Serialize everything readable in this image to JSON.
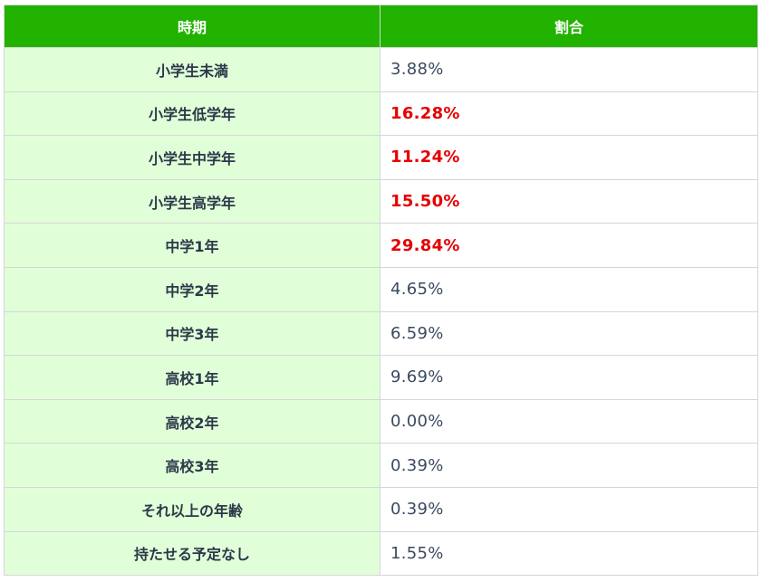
{
  "table": {
    "headers": [
      "時期",
      "割合"
    ],
    "highlight_color": "#e60000",
    "header_color": "#22b200",
    "label_bg_color": "#e0ffd9",
    "rows": [
      {
        "period": "小学生未満",
        "ratio": "3.88%",
        "highlight": false
      },
      {
        "period": "小学生低学年",
        "ratio": "16.28%",
        "highlight": true
      },
      {
        "period": "小学生中学年",
        "ratio": "11.24%",
        "highlight": true
      },
      {
        "period": "小学生高学年",
        "ratio": "15.50%",
        "highlight": true
      },
      {
        "period": "中学1年",
        "ratio": "29.84%",
        "highlight": true
      },
      {
        "period": "中学2年",
        "ratio": "4.65%",
        "highlight": false
      },
      {
        "period": "中学3年",
        "ratio": "6.59%",
        "highlight": false
      },
      {
        "period": "高校1年",
        "ratio": "9.69%",
        "highlight": false
      },
      {
        "period": "高校2年",
        "ratio": "0.00%",
        "highlight": false
      },
      {
        "period": "高校3年",
        "ratio": "0.39%",
        "highlight": false
      },
      {
        "period": "それ以上の年齢",
        "ratio": "0.39%",
        "highlight": false
      },
      {
        "period": "持たせる予定なし",
        "ratio": "1.55%",
        "highlight": false
      }
    ]
  }
}
